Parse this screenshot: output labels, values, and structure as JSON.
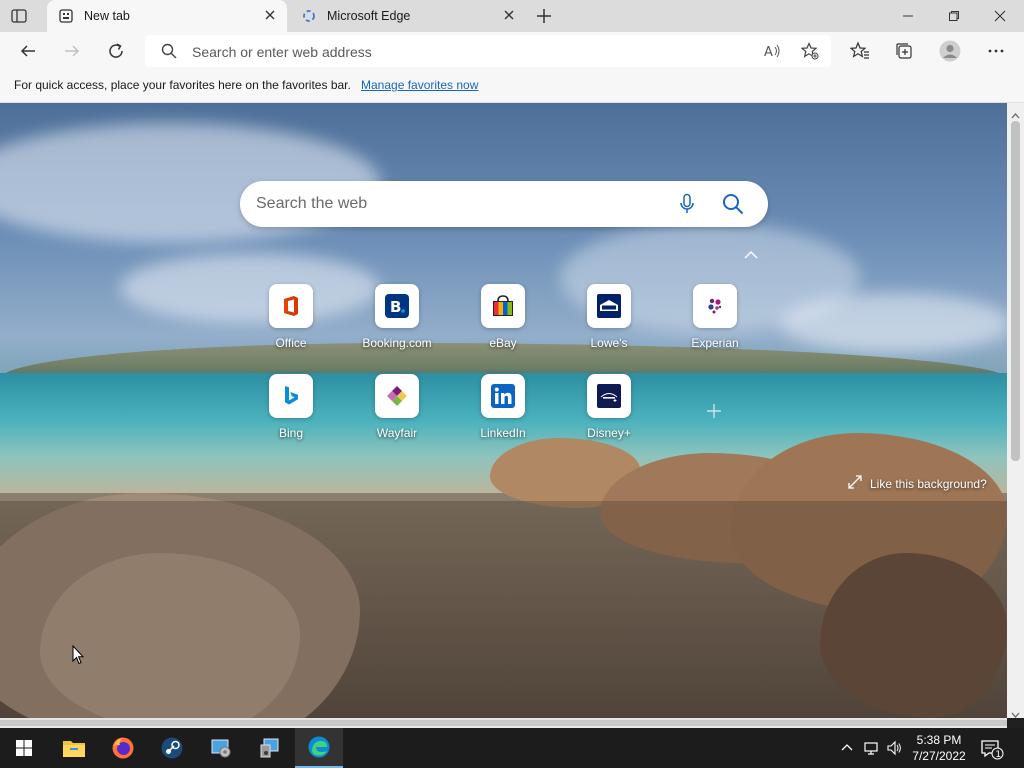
{
  "tabs": [
    {
      "title": "New tab",
      "active": true
    },
    {
      "title": "Microsoft Edge",
      "active": false
    }
  ],
  "address_bar": {
    "placeholder": "Search or enter web address"
  },
  "favorites_bar": {
    "message": "For quick access, place your favorites here on the favorites bar.",
    "link": "Manage favorites now"
  },
  "new_tab_page": {
    "search_placeholder": "Search the web",
    "quick_links": [
      {
        "label": "Office",
        "icon": "office-icon"
      },
      {
        "label": "Booking.com",
        "icon": "booking-icon"
      },
      {
        "label": "eBay",
        "icon": "ebay-icon"
      },
      {
        "label": "Lowe's",
        "icon": "lowes-icon"
      },
      {
        "label": "Experian",
        "icon": "experian-icon"
      },
      {
        "label": "Bing",
        "icon": "bing-icon"
      },
      {
        "label": "Wayfair",
        "icon": "wayfair-icon"
      },
      {
        "label": "LinkedIn",
        "icon": "linkedin-icon"
      },
      {
        "label": "Disney+",
        "icon": "disney-plus-icon"
      }
    ],
    "like_background": "Like this background?"
  },
  "taskbar": {
    "clock_time": "5:38 PM",
    "clock_date": "7/27/2022",
    "notification_count": "1"
  },
  "colors": {
    "accent": "#1765c4",
    "taskbar": "#1c1c1c",
    "tab_strip": "#dcdcdc",
    "toolbar": "#f7f7f7"
  }
}
